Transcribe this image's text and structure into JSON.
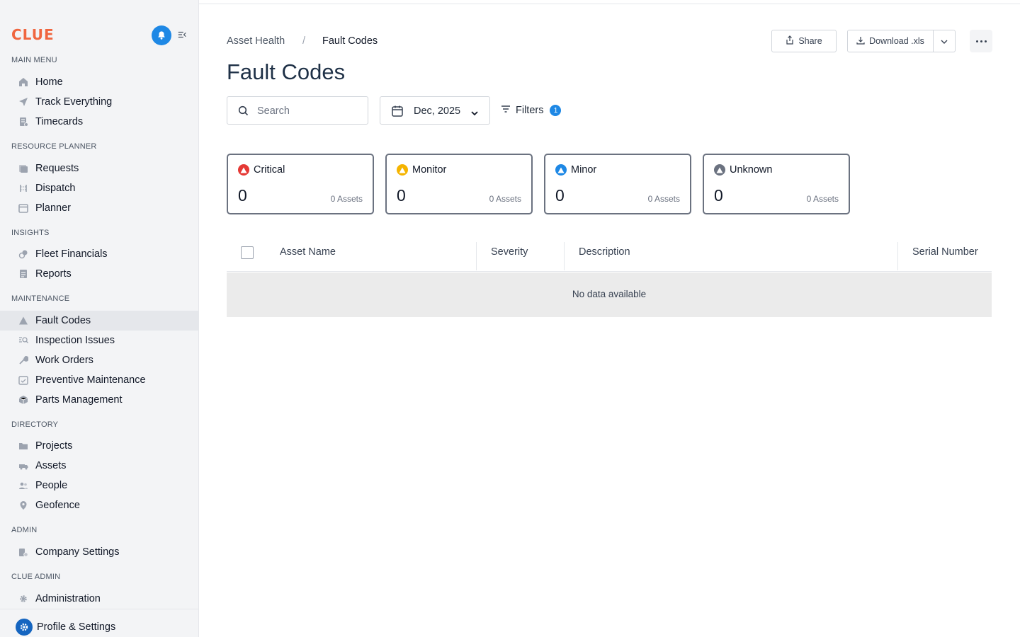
{
  "app": {
    "logo": "CLUE"
  },
  "sidebar": {
    "sections": [
      {
        "label": "MAIN MENU",
        "items": [
          "Home",
          "Track Everything",
          "Timecards"
        ]
      },
      {
        "label": "RESOURCE PLANNER",
        "items": [
          "Requests",
          "Dispatch",
          "Planner"
        ]
      },
      {
        "label": "INSIGHTS",
        "items": [
          "Fleet Financials",
          "Reports"
        ]
      },
      {
        "label": "MAINTENANCE",
        "items": [
          "Fault Codes",
          "Inspection Issues",
          "Work Orders",
          "Preventive Maintenance",
          "Parts Management"
        ]
      },
      {
        "label": "DIRECTORY",
        "items": [
          "Projects",
          "Assets",
          "People",
          "Geofence"
        ]
      },
      {
        "label": "ADMIN",
        "items": [
          "Company Settings"
        ]
      },
      {
        "label": "CLUE ADMIN",
        "items": [
          "Administration"
        ]
      }
    ],
    "active_item": "Fault Codes",
    "footer": {
      "label": "Profile & Settings"
    }
  },
  "breadcrumb": {
    "parent": "Asset Health",
    "separator": "/",
    "current": "Fault Codes"
  },
  "page": {
    "title": "Fault Codes"
  },
  "toolbar": {
    "share_label": "Share",
    "download_label": "Download .xls"
  },
  "filters": {
    "search_placeholder": "Search",
    "date_value": "Dec, 2025",
    "filters_label": "Filters",
    "filters_count": "1"
  },
  "severity_cards": [
    {
      "title": "Critical",
      "value": "0",
      "assets": "0 Assets",
      "color": "#e53935"
    },
    {
      "title": "Monitor",
      "value": "0",
      "assets": "0 Assets",
      "color": "#f5b400"
    },
    {
      "title": "Minor",
      "value": "0",
      "assets": "0 Assets",
      "color": "#1e88e5"
    },
    {
      "title": "Unknown",
      "value": "0",
      "assets": "0 Assets",
      "color": "#6b7280"
    }
  ],
  "table": {
    "columns": [
      "Asset Name",
      "Severity",
      "Description",
      "Serial Number"
    ],
    "empty_message": "No data available"
  },
  "colors": {
    "brand": "#f06640",
    "accent": "#1e88e5"
  }
}
